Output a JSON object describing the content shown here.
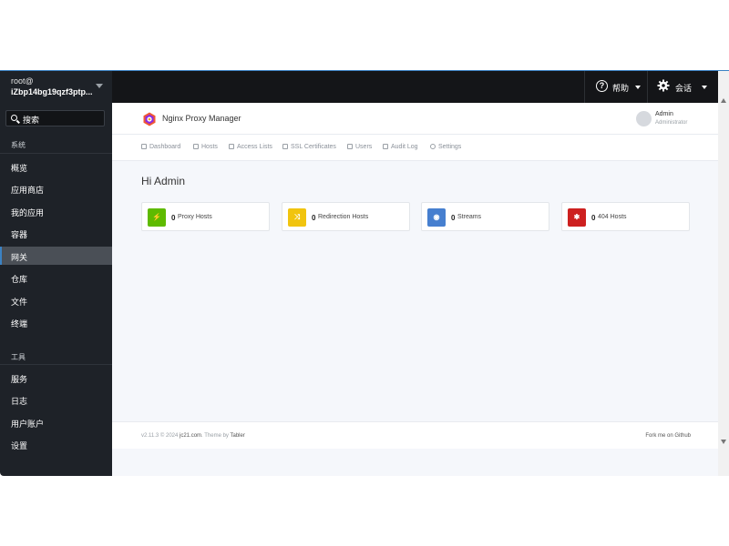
{
  "sidebar": {
    "user": "root@",
    "host": "iZbp14bg19qzf3ptp...",
    "search_label": "搜索",
    "section_system": "系统",
    "section_tools": "工具",
    "items_system": [
      "概览",
      "应用商店",
      "我的应用",
      "容器",
      "网关",
      "仓库",
      "文件",
      "终端"
    ],
    "active_item": "网关",
    "items_tools": [
      "服务",
      "日志",
      "用户账户",
      "设置"
    ]
  },
  "topbar": {
    "help_label": "帮助",
    "session_label": "会话"
  },
  "app": {
    "title": "Nginx Proxy Manager",
    "user_name": "Admin",
    "user_role": "Administrator",
    "nav": [
      "Dashboard",
      "Hosts",
      "Access Lists",
      "SSL Certificates",
      "Users",
      "Audit Log",
      "Settings"
    ],
    "greeting": "Hi Admin",
    "cards": [
      {
        "count": "0",
        "label": "Proxy Hosts",
        "color": "#5eba00",
        "glyph": "⚡"
      },
      {
        "count": "0",
        "label": "Redirection Hosts",
        "color": "#f1c40f",
        "glyph": "⤨"
      },
      {
        "count": "0",
        "label": "Streams",
        "color": "#467fcf",
        "glyph": "◉"
      },
      {
        "count": "0",
        "label": "404 Hosts",
        "color": "#cd201f",
        "glyph": "✱"
      }
    ],
    "footer_version": "v2.11.3 © 2024",
    "footer_company": "jc21.com",
    "footer_theme_prefix": ". Theme by",
    "footer_theme": "Tabler",
    "footer_right": "Fork me on Github"
  }
}
